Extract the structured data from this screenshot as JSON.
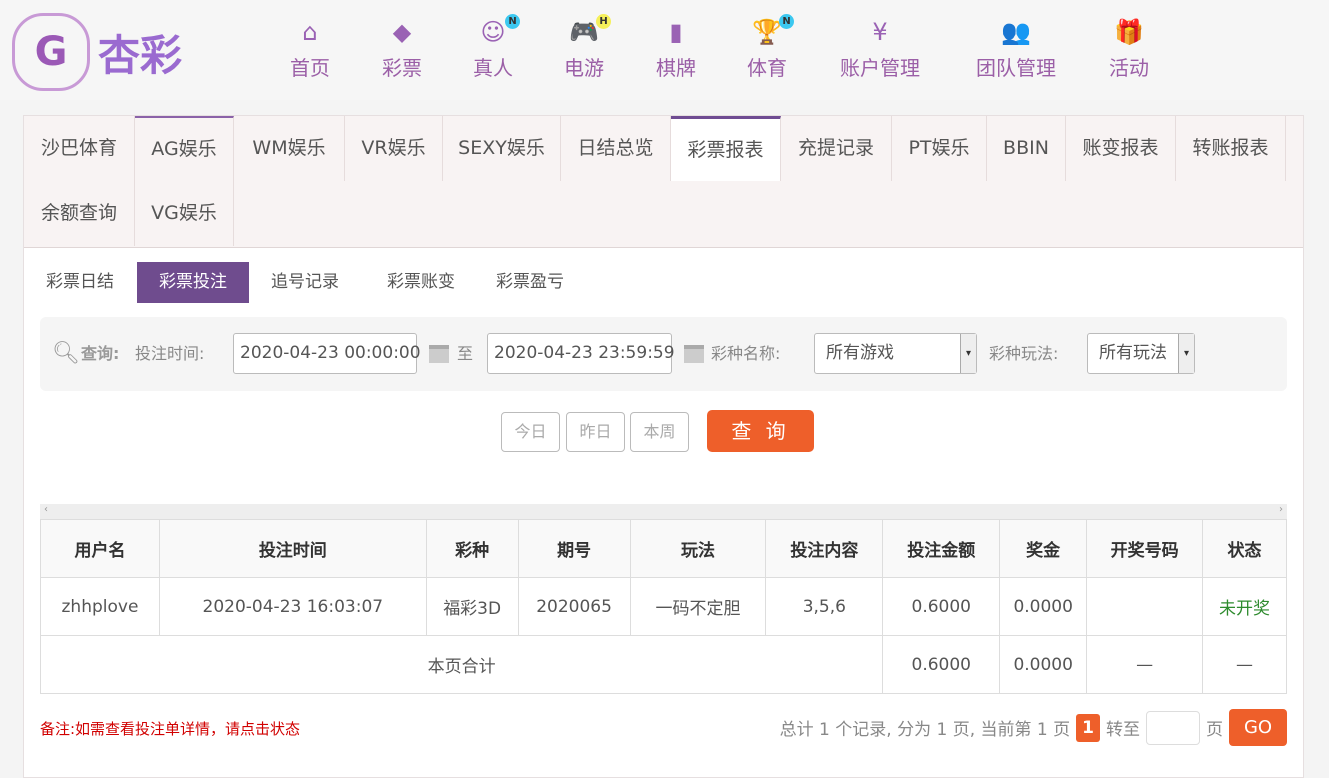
{
  "logo": {
    "text": "杏彩"
  },
  "nav": [
    {
      "label": "首页",
      "icon": "home-icon",
      "glyph": "⌂"
    },
    {
      "label": "彩票",
      "icon": "ticket-icon",
      "glyph": "◆"
    },
    {
      "label": "真人",
      "icon": "live-dealer-icon",
      "glyph": "☺",
      "badge": "N"
    },
    {
      "label": "电游",
      "icon": "gamepad-icon",
      "glyph": "🎮",
      "badge": "H"
    },
    {
      "label": "棋牌",
      "icon": "cards-icon",
      "glyph": "▮"
    },
    {
      "label": "体育",
      "icon": "trophy-icon",
      "glyph": "🏆",
      "badge": "N"
    },
    {
      "label": "账户管理",
      "icon": "yen-coin-icon",
      "glyph": "¥"
    },
    {
      "label": "团队管理",
      "icon": "team-icon",
      "glyph": "👥"
    },
    {
      "label": "活动",
      "icon": "gift-icon",
      "glyph": "🎁"
    }
  ],
  "tabs": [
    "沙巴体育",
    "AG娱乐",
    "WM娱乐",
    "VR娱乐",
    "SEXY娱乐",
    "日结总览",
    "彩票报表",
    "充提记录",
    "PT娱乐",
    "BBIN",
    "账变报表",
    "转账报表",
    "余额查询",
    "VG娱乐"
  ],
  "active_tab": "彩票报表",
  "subtabs": [
    "彩票日结",
    "彩票投注",
    "追号记录",
    "彩票账变",
    "彩票盈亏"
  ],
  "active_subtab": "彩票投注",
  "filter": {
    "query_label": "查询:",
    "time_label": "投注时间:",
    "start": "2020-04-23 00:00:00",
    "to": "至",
    "end": "2020-04-23 23:59:59",
    "lottery_label": "彩种名称:",
    "lottery_value": "所有游戏",
    "play_label": "彩种玩法:",
    "play_value": "所有玩法"
  },
  "quick": [
    "今日",
    "昨日",
    "本周"
  ],
  "search_label": "查 询",
  "table": {
    "headers": [
      "用户名",
      "投注时间",
      "彩种",
      "期号",
      "玩法",
      "投注内容",
      "投注金额",
      "奖金",
      "开奖号码",
      "状态"
    ],
    "rows": [
      [
        "zhhplove",
        "2020-04-23 16:03:07",
        "福彩3D",
        "2020065",
        "一码不定胆",
        "3,5,6",
        "0.6000",
        "0.0000",
        "",
        "未开奖"
      ]
    ],
    "total": {
      "label": "本页合计",
      "amount": "0.6000",
      "bonus": "0.0000",
      "numbers": "—",
      "status": "—"
    }
  },
  "status_color": "#2e8b2e",
  "accent": "#ee5f2a",
  "note": "备注:如需查看投注单详情，请点击状态",
  "pager": {
    "summary": "总计 1 个记录, 分为 1 页, 当前第 1 页",
    "current": "1",
    "goto": "转至",
    "page": "页",
    "go": "GO"
  }
}
